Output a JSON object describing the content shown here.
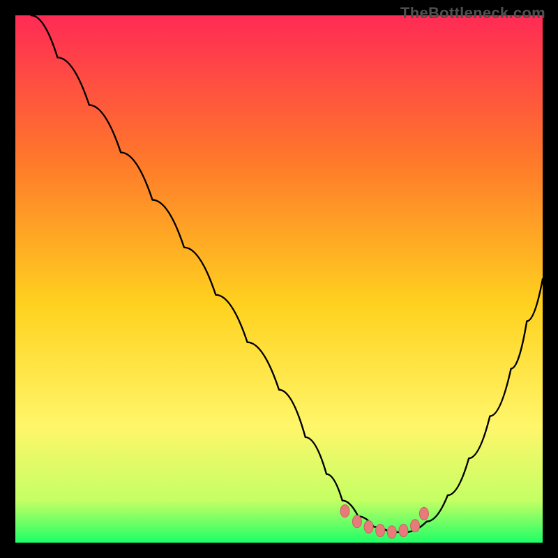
{
  "watermark": "TheBottleneck.com",
  "colors": {
    "frame_bg": "#000000",
    "watermark": "#4f4f4f",
    "curve": "#000000",
    "marker_fill": "#e77b7b",
    "marker_stroke": "#cc5f5f",
    "gradient_top": "#ff2a55",
    "gradient_q1": "#ff7a2a",
    "gradient_mid": "#ffd21f",
    "gradient_q3": "#fff66a",
    "gradient_near_bottom": "#c4ff64",
    "gradient_bottom": "#1eff66"
  },
  "chart_data": {
    "type": "line",
    "title": "",
    "xlabel": "",
    "ylabel": "",
    "xlim": [
      0,
      100
    ],
    "ylim": [
      0,
      100
    ],
    "grid": false,
    "legend": false,
    "series": [
      {
        "name": "bottleneck-curve",
        "x": [
          3,
          8,
          14,
          20,
          26,
          32,
          38,
          44,
          50,
          55,
          59,
          62,
          65,
          68,
          71,
          74,
          78,
          82,
          86,
          90,
          94,
          97,
          100
        ],
        "y": [
          100,
          92,
          83,
          74,
          65,
          56,
          47,
          38,
          29,
          20,
          13,
          8,
          5,
          3,
          2,
          2,
          4,
          9,
          16,
          24,
          33,
          42,
          50
        ]
      }
    ],
    "markers": {
      "name": "optimal-range-dots",
      "x": [
        62.5,
        64.8,
        67.0,
        69.2,
        71.4,
        73.6,
        75.8,
        77.5
      ],
      "y": [
        6.0,
        4.0,
        3.0,
        2.3,
        2.0,
        2.3,
        3.2,
        5.5
      ]
    }
  }
}
